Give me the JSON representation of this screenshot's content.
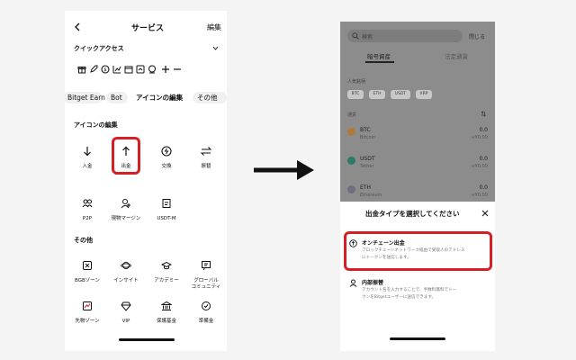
{
  "left": {
    "header": {
      "back_icon": "chevron-left-icon",
      "title": "サービス",
      "edit": "編集"
    },
    "quick_access": {
      "title": "クイックアクセス",
      "icons": [
        "gift-icon",
        "rocket-icon",
        "coin-icon",
        "chart-icon",
        "grid-icon",
        "pie-icon",
        "robot-icon",
        "plus-icon",
        "minus-icon"
      ]
    },
    "tabs": [
      "Bitget Earn",
      "Bot",
      "アイコンの編集",
      "その他"
    ],
    "edit_section": {
      "title": "アイコンの編集",
      "tiles": [
        {
          "label": "入金",
          "icon": "arrow-down-icon"
        },
        {
          "label": "出金",
          "icon": "arrow-up-icon"
        },
        {
          "label": "交換",
          "icon": "swap-icon"
        },
        {
          "label": "振替",
          "icon": "transfer-icon"
        },
        {
          "label": "P2P",
          "icon": "people-icon"
        },
        {
          "label": "現物マージン",
          "icon": "margin-icon"
        },
        {
          "label": "USDT-M",
          "icon": "contract-icon"
        }
      ]
    },
    "other_section": {
      "title": "その他",
      "tiles": [
        {
          "label": "BGBゾーン",
          "icon": "bgb-icon"
        },
        {
          "label": "インサイト",
          "icon": "planet-icon"
        },
        {
          "label": "アカデミー",
          "icon": "cap-icon"
        },
        {
          "label1": "グローバル",
          "label2": "コミュニティ",
          "icon": "chat-icon"
        },
        {
          "label": "先物ゾーン",
          "icon": "futures-icon"
        },
        {
          "label": "VIP",
          "icon": "diamond-icon"
        },
        {
          "label": "保護基金",
          "icon": "bank-icon"
        },
        {
          "label": "準備金",
          "icon": "reserve-icon"
        }
      ]
    }
  },
  "arrow_icon": "right-arrow-icon",
  "right": {
    "search": {
      "placeholder": "検索",
      "close": "閉じる"
    },
    "tabs": [
      "暗号資産",
      "法定通貨"
    ],
    "recent_label": "人気銘柄",
    "chips": [
      "BTC",
      "ETH",
      "USDT",
      "XRP"
    ],
    "list_label": "通貨",
    "coins": [
      {
        "symbol": "BTC",
        "name": "Bitcoin",
        "amount": "0.0",
        "value": "≈¥0.00"
      },
      {
        "symbol": "USDT",
        "name": "Tether",
        "amount": "0.0",
        "value": "≈¥0.00"
      },
      {
        "symbol": "ETH",
        "name": "Ethereum",
        "amount": "0.0",
        "value": "≈¥0.00"
      }
    ],
    "sheet": {
      "title": "出金タイプを選択してください",
      "options": [
        {
          "title": "オンチェーン出金",
          "desc1": "ブロックチェーンネットワーク経由で受取人のアドレス",
          "desc2": "にトークンを送信します。"
        },
        {
          "title": "内部振替",
          "desc1": "アカウント名を入力することで、手数料無料でトー",
          "desc2": "クンをBitgetユーザーに送信できます。"
        }
      ]
    }
  },
  "colors": {
    "highlight": "#d61f25",
    "overlay": "#8c8c8c",
    "accent": "#1fa0b3"
  }
}
